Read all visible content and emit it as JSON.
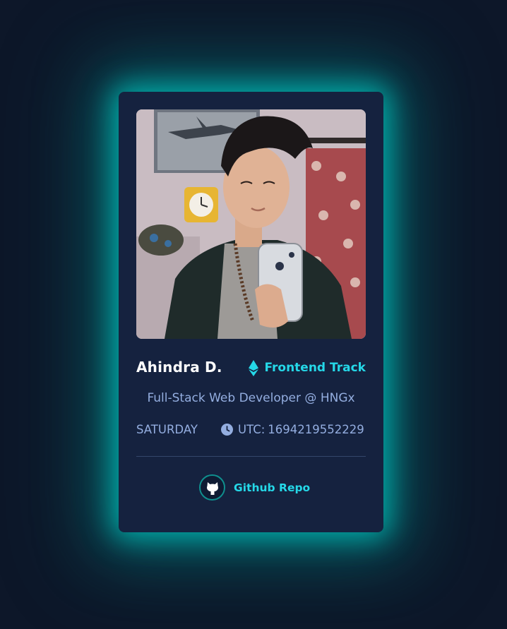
{
  "profile": {
    "name": "Ahindra D.",
    "track": "Frontend Track",
    "role": "Full-Stack Web Developer @ HNGx",
    "day": "SATURDAY",
    "utc_label": "UTC:",
    "utc_value": "1694219552229"
  },
  "links": {
    "github_label": "Github Repo"
  },
  "icons": {
    "track": "ethereum-icon",
    "time": "clock-icon",
    "github": "github-icon"
  },
  "colors": {
    "background": "#0d1729",
    "card": "#15223f",
    "accent": "#25d8e8",
    "glow": "#00bebb",
    "muted_text": "#94aee0",
    "name_text": "#ffffff"
  }
}
